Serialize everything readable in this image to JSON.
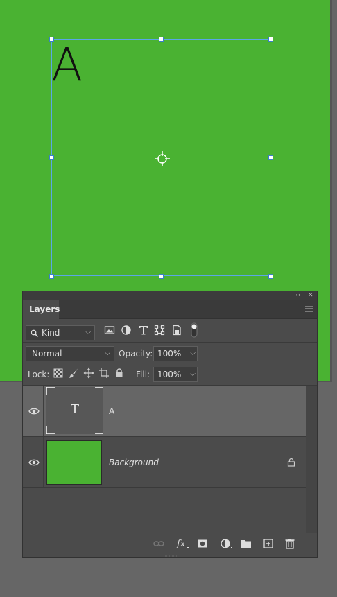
{
  "canvas": {
    "background_color": "#4ab232",
    "text_layer_content": "A"
  },
  "panel": {
    "tab_label": "Layers",
    "collapse_icon": "double-chevron-left-icon",
    "close_icon": "close-icon",
    "filter": {
      "kind_label": "Kind",
      "icons": [
        "pixel-filter-icon",
        "adjustment-filter-icon",
        "type-filter-icon",
        "shape-filter-icon",
        "smart-object-filter-icon",
        "filter-toggle-icon"
      ]
    },
    "blend_mode": "Normal",
    "opacity_label": "Opacity:",
    "opacity_value": "100%",
    "lock_label": "Lock:",
    "fill_label": "Fill:",
    "fill_value": "100%",
    "layers": [
      {
        "name": "A",
        "type": "text",
        "thumb_glyph": "T",
        "visible": true,
        "selected": true
      },
      {
        "name": "Background",
        "type": "pixel",
        "visible": true,
        "locked": true,
        "thumb_color": "#4ab232"
      }
    ],
    "footer_icons": [
      "link-layers-icon",
      "fx-icon",
      "add-mask-icon",
      "adjustment-layer-icon",
      "new-group-icon",
      "new-layer-icon",
      "trash-icon"
    ]
  }
}
